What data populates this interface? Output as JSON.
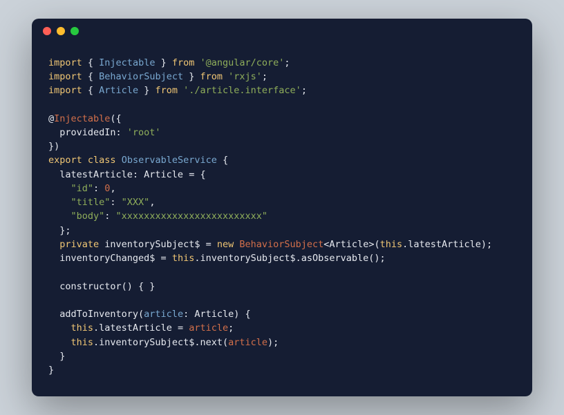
{
  "code": {
    "l1_import": "import",
    "l1_open": " { ",
    "l1_name": "Injectable",
    "l1_close": " } ",
    "l1_from": "from",
    "l1_sp": " ",
    "l1_str": "'@angular/core'",
    "l1_semi": ";",
    "l2_import": "import",
    "l2_open": " { ",
    "l2_name": "BehaviorSubject",
    "l2_close": " } ",
    "l2_from": "from",
    "l2_sp": " ",
    "l2_str": "'rxjs'",
    "l2_semi": ";",
    "l3_import": "import",
    "l3_open": " { ",
    "l3_name": "Article",
    "l3_close": " } ",
    "l3_from": "from",
    "l3_sp": " ",
    "l3_str": "'./article.interface'",
    "l3_semi": ";",
    "l5_at": "@",
    "l5_dec": "Injectable",
    "l5_paren": "({",
    "l6_key": "  providedIn: ",
    "l6_str": "'root'",
    "l7_close": "})",
    "l8_export": "export",
    "l8_sp1": " ",
    "l8_class": "class",
    "l8_sp2": " ",
    "l8_name": "ObservableService",
    "l8_brace": " {",
    "l9": "  latestArticle: Article = {",
    "l10_key": "    \"id\"",
    "l10_colon": ": ",
    "l10_val": "0",
    "l10_comma": ",",
    "l11_key": "    \"title\"",
    "l11_colon": ": ",
    "l11_val": "\"XXX\"",
    "l11_comma": ",",
    "l12_key": "    \"body\"",
    "l12_colon": ": ",
    "l12_val": "\"xxxxxxxxxxxxxxxxxxxxxxxxx\"",
    "l13": "  };",
    "l14_priv": "  private",
    "l14_name": " inventorySubject$ = ",
    "l14_new": "new",
    "l14_sp": " ",
    "l14_ctor": "BehaviorSubject",
    "l14_gen": "<Article>(",
    "l14_this": "this",
    "l14_rest": ".latestArticle);",
    "l15_a": "  inventoryChanged$ = ",
    "l15_this": "this",
    "l15_b": ".inventorySubject$.asObservable();",
    "l17": "  constructor() { }",
    "l19_a": "  addToInventory(",
    "l19_param": "article",
    "l19_b": ": Article) {",
    "l20_ind": "    ",
    "l20_this": "this",
    "l20_a": ".latestArticle = ",
    "l20_arg": "article",
    "l20_semi": ";",
    "l21_ind": "    ",
    "l21_this": "this",
    "l21_a": ".inventorySubject$.next(",
    "l21_arg": "article",
    "l21_b": ");",
    "l22": "  }",
    "l23": "}"
  }
}
